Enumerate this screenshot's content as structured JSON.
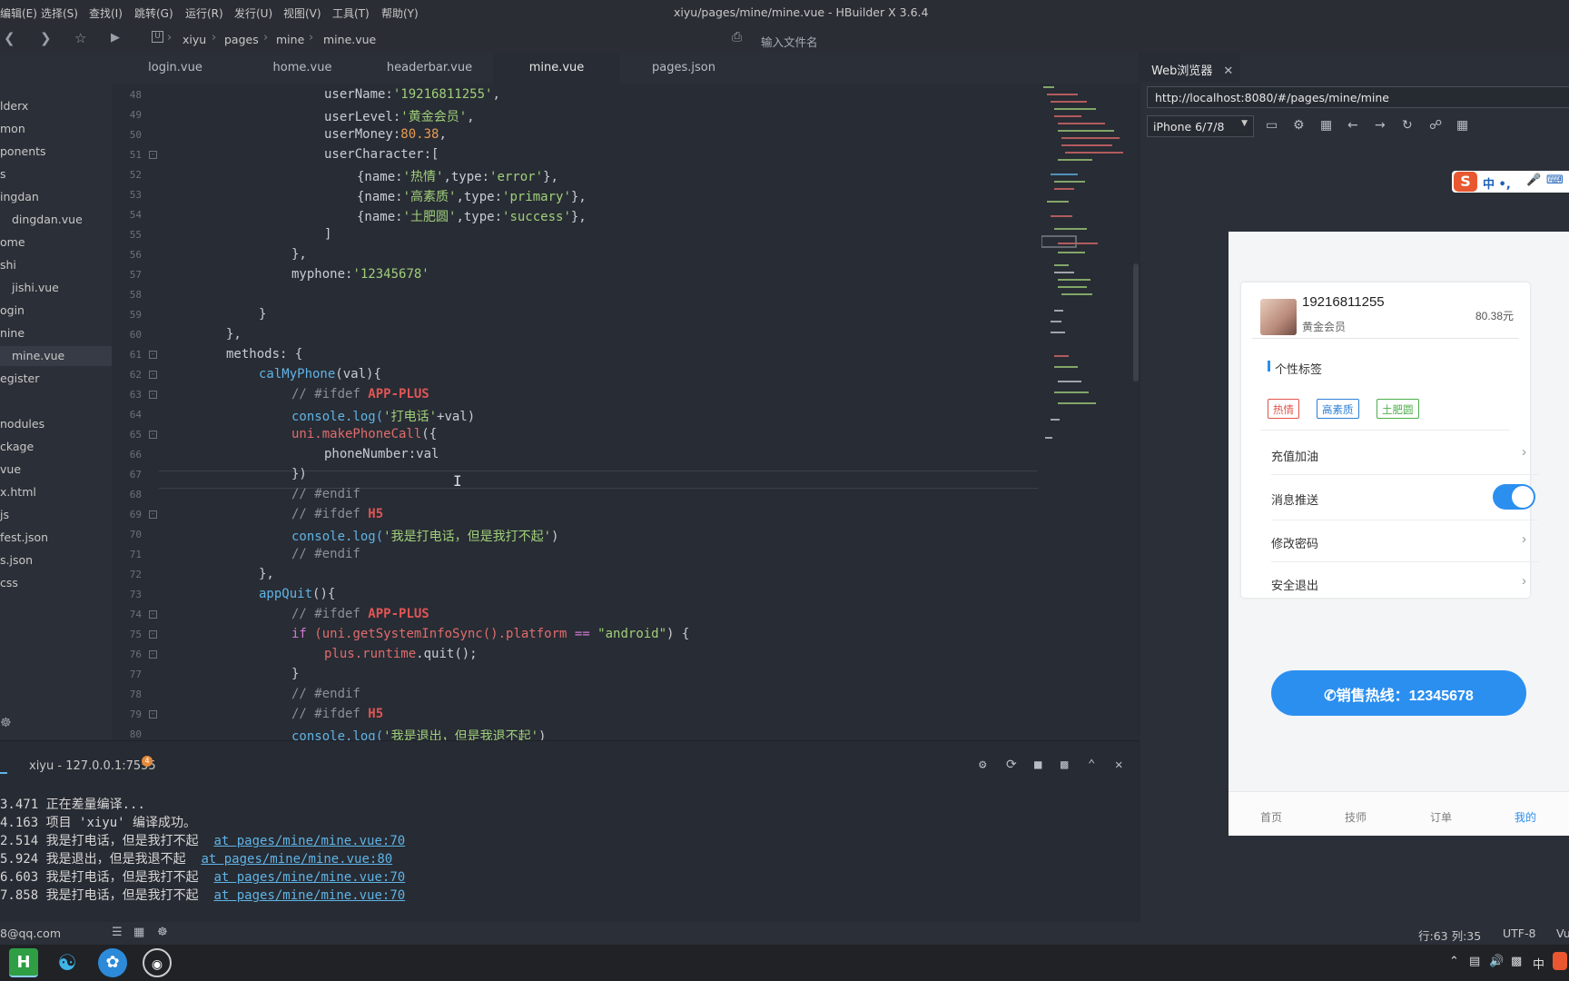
{
  "menubar": {
    "items": [
      "编辑(E)",
      "选择(S)",
      "查找(I)",
      "跳转(G)",
      "运行(R)",
      "发行(U)",
      "视图(V)",
      "工具(T)",
      "帮助(Y)"
    ],
    "window_title": "xiyu/pages/mine/mine.vue - HBuilder X 3.6.4"
  },
  "navbar": {
    "breadcrumb": [
      "xiyu",
      "pages",
      "mine",
      "mine.vue"
    ],
    "file_search_placeholder": "输入文件名"
  },
  "sidebar": {
    "items": [
      "lderx",
      "mon",
      "ponents",
      "s",
      "ingdan",
      "dingdan.vue",
      "ome",
      "shi",
      "jishi.vue",
      "ogin",
      "nine",
      "mine.vue",
      "egister",
      "",
      "nodules",
      "ckage",
      "vue",
      "x.html",
      "js",
      "fest.json",
      "s.json",
      "css"
    ]
  },
  "editor": {
    "tabs": [
      "login.vue",
      "home.vue",
      "headerbar.vue",
      "mine.vue",
      "pages.json"
    ],
    "active_tab": "mine.vue",
    "line_numbers": [
      "48",
      "49",
      "50",
      "51",
      "52",
      "53",
      "54",
      "55",
      "56",
      "57",
      "58",
      "59",
      "60",
      "61",
      "62",
      "63",
      "64",
      "65",
      "66",
      "67",
      "68",
      "69",
      "70",
      "71",
      "72",
      "73",
      "74",
      "75",
      "76",
      "77",
      "78",
      "79",
      "80"
    ],
    "code": {
      "l48_prop": "userName:",
      "l48_val": "'19216811255'",
      "l48_end": ",",
      "l49_prop": "userLevel:",
      "l49_val": "'黄金会员'",
      "l49_end": ",",
      "l50_prop": "userMoney:",
      "l50_val": "80.38",
      "l50_end": ",",
      "l51": "userCharacter:[",
      "l52_a": "{name:",
      "l52_b": "'热情'",
      "l52_c": ",type:",
      "l52_d": "'error'",
      "l52_e": "},",
      "l53_a": "{name:",
      "l53_b": "'高素质'",
      "l53_c": ",type:",
      "l53_d": "'primary'",
      "l53_e": "},",
      "l54_a": "{name:",
      "l54_b": "'土肥圆'",
      "l54_c": ",type:",
      "l54_d": "'success'",
      "l54_e": "},",
      "l55": "]",
      "l56": "},",
      "l57_prop": "myphone:",
      "l57_val": "'12345678'",
      "l59": "}",
      "l60": "},",
      "l61": "methods: {",
      "l62_fn": "calMyPhone",
      "l62_rest": "(val){",
      "l63_cm": "// #ifdef ",
      "l63_pp": "APP-PLUS",
      "l64_fn": "console.log(",
      "l64_str": "'打电话'",
      "l64_rest": "+val)",
      "l65_obj": "uni.makePhoneCall",
      "l65_rest": "({",
      "l66": "phoneNumber:val",
      "l67": "})",
      "l68_cm": "// #endif",
      "l69_cm": "// #ifdef ",
      "l69_pp": "H5",
      "l70_fn": "console.log(",
      "l70_str": "'我是打电话，但是我打不起'",
      "l70_rest": ")",
      "l71_cm": "// #endif",
      "l72": "},",
      "l73_fn": "appQuit",
      "l73_rest": "(){",
      "l74_cm": "// #ifdef ",
      "l74_pp": "APP-PLUS",
      "l75_kw": "if ",
      "l75_a": "(uni.getSystemInfoSync().",
      "l75_b": "platform",
      "l75_c": " == ",
      "l75_d": "\"android\"",
      "l75_e": ") {",
      "l76_a": "plus.",
      "l76_b": "runtime",
      "l76_c": ".quit();",
      "l77": "}",
      "l78_cm": "// #endif",
      "l79_cm": "// #ifdef ",
      "l79_pp": "H5",
      "l80_fn": "console.log(",
      "l80_str": "'我是退出，但是我退不起'",
      "l80_rest": ")"
    }
  },
  "console": {
    "title": "xiyu - 127.0.0.1:7555",
    "badge": "4",
    "lines": [
      {
        "ts": "3.471",
        "msg": " 正在差量编译...",
        "link": ""
      },
      {
        "ts": "4.163",
        "msg": " 项目 'xiyu' 编译成功。",
        "link": ""
      },
      {
        "ts": "2.514",
        "msg": " 我是打电话，但是我打不起  ",
        "link": "at pages/mine/mine.vue:70"
      },
      {
        "ts": "5.924",
        "msg": " 我是退出，但是我退不起  ",
        "link": "at pages/mine/mine.vue:80"
      },
      {
        "ts": "6.603",
        "msg": " 我是打电话，但是我打不起  ",
        "link": "at pages/mine/mine.vue:70"
      },
      {
        "ts": "7.858",
        "msg": " 我是打电话，但是我打不起  ",
        "link": "at pages/mine/mine.vue:70"
      }
    ]
  },
  "statusbar": {
    "account": "8@qq.com",
    "position": "行:63  列:35",
    "encoding": "UTF-8",
    "extra": "Vu"
  },
  "browser": {
    "tab_label": "Web浏览器",
    "url": "http://localhost:8080/#/pages/mine/mine",
    "device": "iPhone 6/7/8",
    "ime_text": "中 •, ",
    "phone": {
      "username": "19216811255",
      "level": "黄金会员",
      "money": "80.38元",
      "section_title": "个性标签",
      "tags": [
        "热情",
        "高素质",
        "土肥圆"
      ],
      "rows": [
        "充值加油",
        "消息推送",
        "修改密码",
        "安全退出"
      ],
      "push_enabled": true,
      "hotline": "销售热线：12345678",
      "tabbar": [
        "首页",
        "技师",
        "订单",
        "我的"
      ],
      "active_tab": "我的"
    }
  },
  "colors": {
    "accent_blue": "#2b8ff0",
    "tag_error": "#e0534a",
    "tag_primary": "#2b7fd6",
    "tag_success": "#4cae4c"
  }
}
